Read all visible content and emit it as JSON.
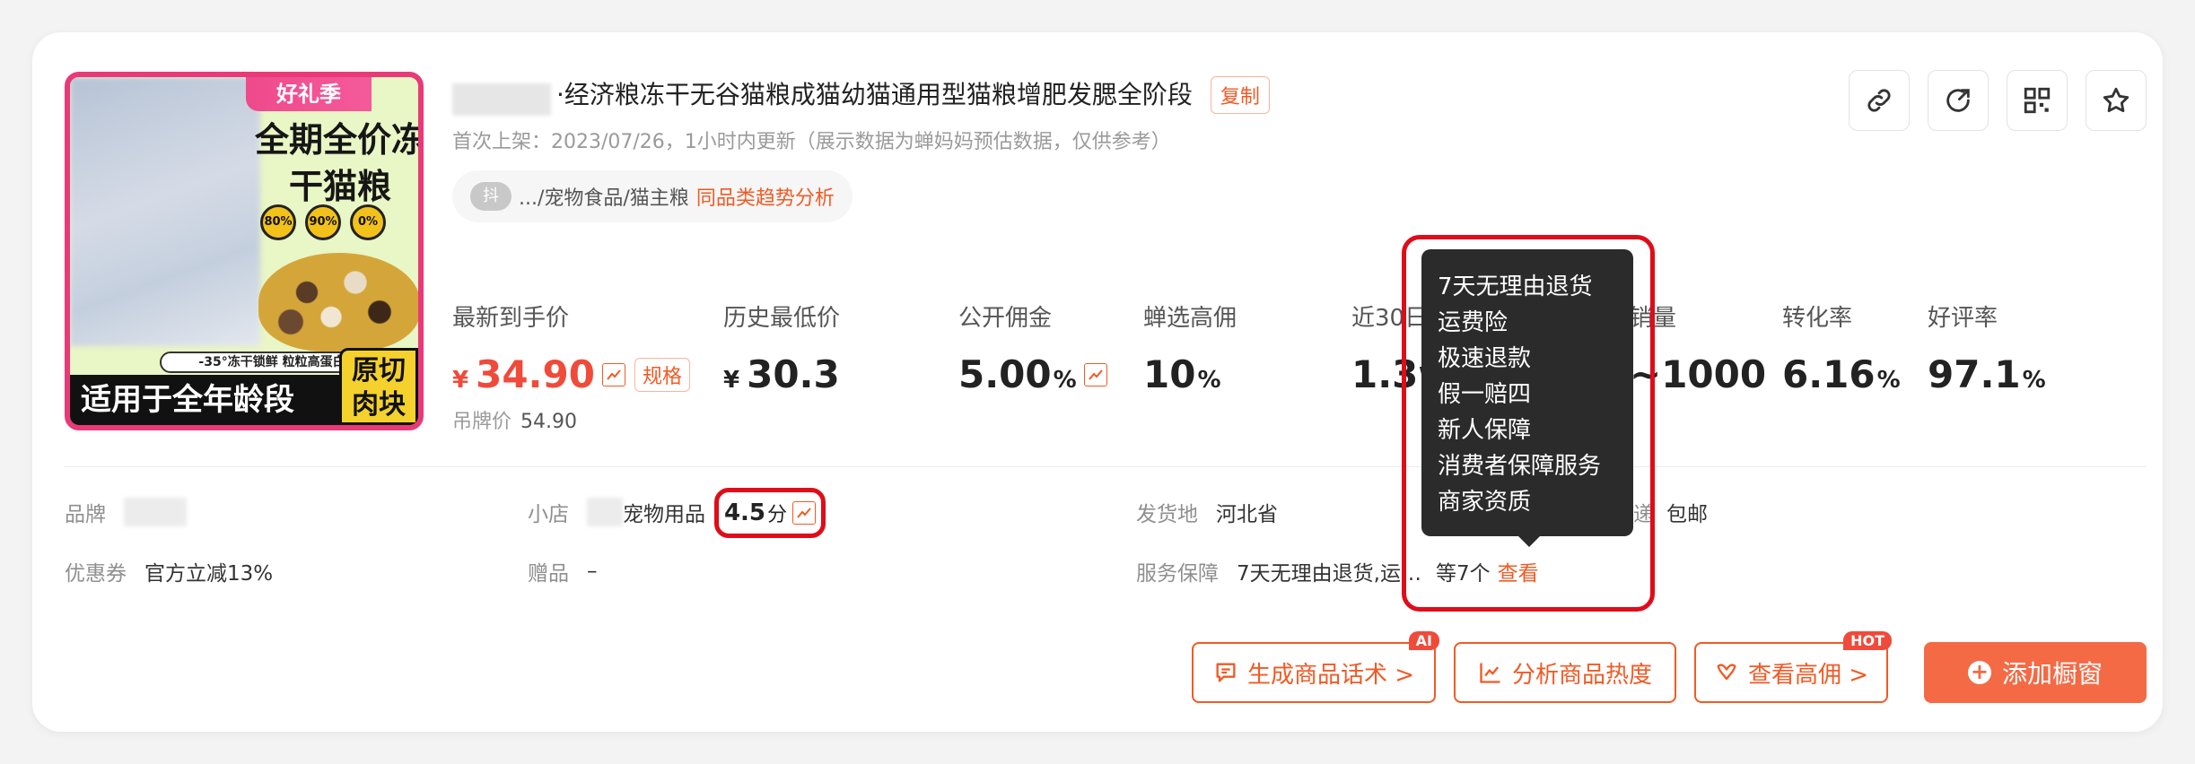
{
  "product": {
    "image": {
      "tag": "好礼季",
      "headline": "全期全价冻干猫粮",
      "badges": [
        "80%",
        "90%",
        "0%"
      ],
      "slogan": "-35°冻干锁鲜 粒粒高蛋白",
      "bottom_text": "适用于全年龄段",
      "corner_text": "原切肉块"
    },
    "title": "·经济粮冻干无谷猫粮成猫幼猫通用型猫粮增肥发腮全阶段",
    "copy_label": "复制",
    "subtitle": "首次上架：2023/07/26，1小时内更新（展示数据为蝉妈妈预估数据，仅供参考）",
    "category_platform": "抖",
    "category": ".../宠物食品/猫主粮",
    "category_link": "同品类趋势分析"
  },
  "actions": {
    "icons": [
      "link-icon",
      "share-icon",
      "qrcode-icon",
      "star-icon"
    ]
  },
  "metrics": [
    {
      "label": "最新到手价",
      "currency": "¥",
      "value": "34.90",
      "unit": "",
      "has_trend": true,
      "spec_label": "规格"
    },
    {
      "label": "历史最低价",
      "currency": "¥",
      "value": "30.3",
      "unit": ""
    },
    {
      "label": "公开佣金",
      "value": "5.00",
      "unit": "%",
      "has_trend": true
    },
    {
      "label": "蝉选高佣",
      "value": "10",
      "unit": "%"
    },
    {
      "label": "近30日",
      "value": "1.3w",
      "unit": ""
    },
    {
      "label": "销量",
      "value": "~1000",
      "unit": ""
    },
    {
      "label": "转化率",
      "value": "6.16",
      "unit": "%"
    },
    {
      "label": "好评率",
      "value": "97.1",
      "unit": "%"
    }
  ],
  "tag_price": {
    "label": "吊牌价",
    "value": "54.90"
  },
  "info": {
    "brand_label": "品牌",
    "shop_label": "小店",
    "shop_name_suffix": "宠物用品",
    "shop_score": "4.5",
    "shop_score_unit": "分",
    "ship_from_label": "发货地",
    "ship_from_value": "河北省",
    "shipping_label": "递",
    "shipping_value": "包邮",
    "coupon_label": "优惠券",
    "coupon_value": "官方立减13%",
    "gift_label": "赠品",
    "gift_value": "–",
    "service_label": "服务保障",
    "service_value": "7天无理由退货,运…",
    "service_count": "等7个",
    "service_view": "查看"
  },
  "tooltip": {
    "lines": [
      "7天无理由退货",
      "运费险",
      "极速退款",
      "假一赔四",
      "新人保障",
      "消费者保障服务",
      "商家资质"
    ]
  },
  "buttons": {
    "gen_script": "生成商品话术 >",
    "gen_badge": "AI",
    "analyze": "分析商品热度",
    "high_comm": "查看高佣 >",
    "high_badge": "HOT",
    "add_window": "添加橱窗"
  },
  "colors": {
    "accent": "#f15a24",
    "price_red": "#f04a3a",
    "highlight_red": "#e00c19",
    "primary_button": "#f46a45"
  }
}
